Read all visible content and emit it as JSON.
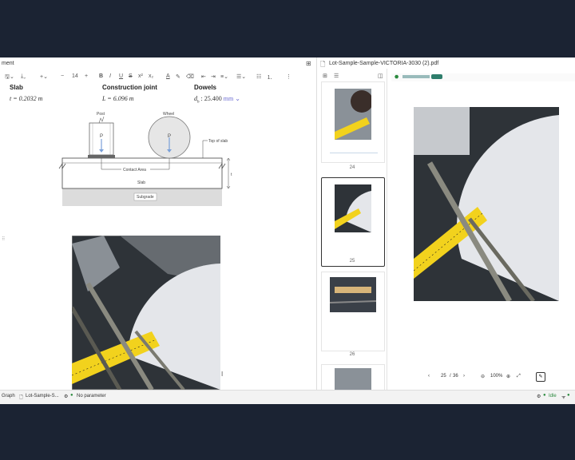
{
  "left_pane": {
    "title": "ment",
    "font_size": "14",
    "columns": [
      {
        "header": "Slab",
        "value": "t = 0.2032 m"
      },
      {
        "header": "Construction joint",
        "value": "L = 6.096 m"
      },
      {
        "header": "Dowels",
        "value_prefix": "d",
        "value_sub": "b",
        "value_main": " : 25.400",
        "value_unit": "mm"
      }
    ],
    "diagram": {
      "post": "Post",
      "wheel": "Wheel",
      "load_left": "P",
      "load_right": "P",
      "top_of_slab": "Top of slab",
      "contact_area": "Contact Area",
      "slab": "Slab",
      "subgrade": "Subgrade",
      "thickness": "t"
    }
  },
  "right_pane": {
    "file_title": "Lot-Sample-Sample-VICTORIA-3030 (2).pdf",
    "thumbnails": [
      {
        "page": "24"
      },
      {
        "page": "25",
        "selected": true
      },
      {
        "page": "26"
      }
    ],
    "pager": {
      "current": "25",
      "sep": "/",
      "total": "36",
      "zoom": "100%"
    }
  },
  "status_bar": {
    "graph_label": "Graph",
    "file_label": "Lot-Sample-S...",
    "param_label": "No parameter",
    "idle_label": "Idle"
  },
  "colors": {
    "accent": "#2b8a3e",
    "unit": "#6b6bd1",
    "selection": "#333333"
  }
}
